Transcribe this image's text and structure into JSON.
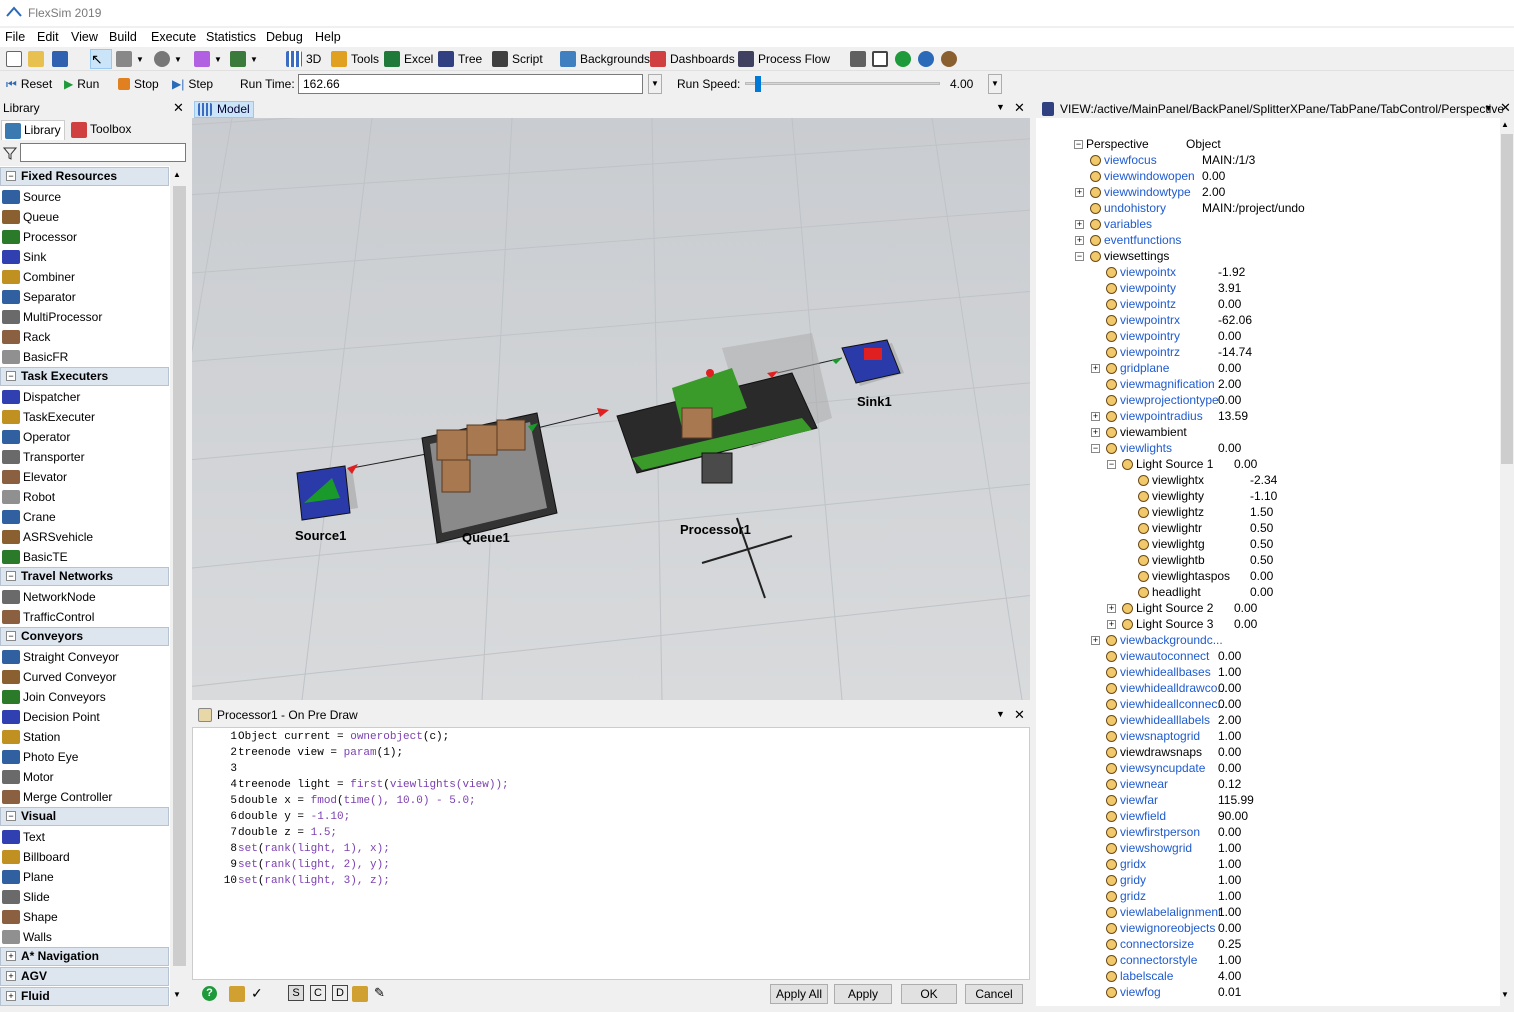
{
  "app": {
    "title": "FlexSim 2019",
    "menu": [
      "File",
      "Edit",
      "View",
      "Build",
      "Execute",
      "Statistics",
      "Debug",
      "Help"
    ]
  },
  "toolbar": {
    "d3": "3D",
    "tools": "Tools",
    "excel": "Excel",
    "tree": "Tree",
    "script": "Script",
    "backgrounds": "Backgrounds",
    "dashboards": "Dashboards",
    "processflow": "Process Flow"
  },
  "runbar": {
    "reset": "Reset",
    "run": "Run",
    "stop": "Stop",
    "step": "Step",
    "runtime_label": "Run Time:",
    "runtime_value": "162.66",
    "runspeed_label": "Run Speed:",
    "runspeed_value": "4.00",
    "runspeed_level": 0.05
  },
  "library": {
    "title": "Library",
    "tab_library": "Library",
    "tab_toolbox": "Toolbox",
    "categories": [
      {
        "name": "Fixed Resources",
        "items": [
          "Source",
          "Queue",
          "Processor",
          "Sink",
          "Combiner",
          "Separator",
          "MultiProcessor",
          "Rack",
          "BasicFR"
        ]
      },
      {
        "name": "Task Executers",
        "items": [
          "Dispatcher",
          "TaskExecuter",
          "Operator",
          "Transporter",
          "Elevator",
          "Robot",
          "Crane",
          "ASRSvehicle",
          "BasicTE"
        ]
      },
      {
        "name": "Travel Networks",
        "items": [
          "NetworkNode",
          "TrafficControl"
        ]
      },
      {
        "name": "Conveyors",
        "items": [
          "Straight Conveyor",
          "Curved Conveyor",
          "Join Conveyors",
          "Decision Point",
          "Station",
          "Photo Eye",
          "Motor",
          "Merge Controller"
        ]
      },
      {
        "name": "Visual",
        "items": [
          "Text",
          "Billboard",
          "Plane",
          "Slide",
          "Shape",
          "Walls"
        ]
      },
      {
        "name": "A* Navigation",
        "items": []
      },
      {
        "name": "AGV",
        "items": []
      },
      {
        "name": "Fluid",
        "items": []
      }
    ]
  },
  "model": {
    "tab": "Model",
    "labels": {
      "source": "Source1",
      "queue": "Queue1",
      "processor": "Processor1",
      "sink": "Sink1"
    }
  },
  "code": {
    "title": "Processor1 - On Pre Draw",
    "lines": [
      [
        "1",
        "Object current = ",
        "ownerobject",
        "(c);",
        ""
      ],
      [
        "2",
        "treenode view = ",
        "param",
        "(1);",
        ""
      ],
      [
        "3",
        "",
        "",
        "",
        ""
      ],
      [
        "4",
        "treenode light = ",
        "first",
        "(",
        "viewlights(view));"
      ],
      [
        "5",
        "double x = ",
        "fmod",
        "(",
        "time(), 10.0) - 5.0;"
      ],
      [
        "6",
        "double y = ",
        "",
        "",
        "-1.10;"
      ],
      [
        "7",
        "double z = ",
        "",
        "",
        "1.5;"
      ],
      [
        "8",
        "",
        "set",
        "(",
        "rank(light, 1), x);"
      ],
      [
        "9",
        "",
        "set",
        "(",
        "rank(light, 2), y);"
      ],
      [
        "10",
        "",
        "set",
        "(",
        "rank(light, 3), z);"
      ]
    ],
    "buttons": {
      "apply_all": "Apply All",
      "apply": "Apply",
      "ok": "OK",
      "cancel": "Cancel"
    }
  },
  "tree": {
    "title": "VIEW:/active/MainPanel/BackPanel/SplitterXPane/TabPane/TabControl/Perspective",
    "root": "Perspective",
    "root_value": "Object",
    "nodes": [
      {
        "name": "viewfocus",
        "value": "MAIN:/1/3",
        "level": 1,
        "blue": true,
        "pm": ""
      },
      {
        "name": "viewwindowopen",
        "value": "0.00",
        "level": 1,
        "blue": true,
        "pm": ""
      },
      {
        "name": "viewwindowtype",
        "value": "2.00",
        "level": 1,
        "blue": true,
        "pm": "+"
      },
      {
        "name": "undohistory",
        "value": "MAIN:/project/undo",
        "level": 1,
        "blue": true,
        "pm": ""
      },
      {
        "name": "variables",
        "value": "",
        "level": 1,
        "blue": true,
        "pm": "+"
      },
      {
        "name": "eventfunctions",
        "value": "",
        "level": 1,
        "blue": true,
        "pm": "+"
      },
      {
        "name": "viewsettings",
        "value": "",
        "level": 1,
        "blue": false,
        "pm": "-"
      },
      {
        "name": "viewpointx",
        "value": "-1.92",
        "level": 2,
        "blue": true,
        "pm": ""
      },
      {
        "name": "viewpointy",
        "value": "3.91",
        "level": 2,
        "blue": true,
        "pm": ""
      },
      {
        "name": "viewpointz",
        "value": "0.00",
        "level": 2,
        "blue": true,
        "pm": ""
      },
      {
        "name": "viewpointrx",
        "value": "-62.06",
        "level": 2,
        "blue": true,
        "pm": ""
      },
      {
        "name": "viewpointry",
        "value": "0.00",
        "level": 2,
        "blue": true,
        "pm": ""
      },
      {
        "name": "viewpointrz",
        "value": "-14.74",
        "level": 2,
        "blue": true,
        "pm": ""
      },
      {
        "name": "gridplane",
        "value": "0.00",
        "level": 2,
        "blue": true,
        "pm": "+"
      },
      {
        "name": "viewmagnification",
        "value": "2.00",
        "level": 2,
        "blue": true,
        "pm": ""
      },
      {
        "name": "viewprojectiontype",
        "value": "0.00",
        "level": 2,
        "blue": true,
        "pm": ""
      },
      {
        "name": "viewpointradius",
        "value": "13.59",
        "level": 2,
        "blue": true,
        "pm": "+"
      },
      {
        "name": "viewambient",
        "value": "",
        "level": 2,
        "blue": false,
        "pm": "+"
      },
      {
        "name": "viewlights",
        "value": "0.00",
        "level": 2,
        "blue": true,
        "pm": "-"
      },
      {
        "name": "Light Source 1",
        "value": "0.00",
        "level": 3,
        "blue": false,
        "pm": "-"
      },
      {
        "name": "viewlightx",
        "value": "-2.34",
        "level": 4,
        "blue": false,
        "pm": ""
      },
      {
        "name": "viewlighty",
        "value": "-1.10",
        "level": 4,
        "blue": false,
        "pm": ""
      },
      {
        "name": "viewlightz",
        "value": "1.50",
        "level": 4,
        "blue": false,
        "pm": ""
      },
      {
        "name": "viewlightr",
        "value": "0.50",
        "level": 4,
        "blue": false,
        "pm": ""
      },
      {
        "name": "viewlightg",
        "value": "0.50",
        "level": 4,
        "blue": false,
        "pm": ""
      },
      {
        "name": "viewlightb",
        "value": "0.50",
        "level": 4,
        "blue": false,
        "pm": ""
      },
      {
        "name": "viewlightaspos",
        "value": "0.00",
        "level": 4,
        "blue": false,
        "pm": ""
      },
      {
        "name": "headlight",
        "value": "0.00",
        "level": 4,
        "blue": false,
        "pm": ""
      },
      {
        "name": "Light Source 2",
        "value": "0.00",
        "level": 3,
        "blue": false,
        "pm": "+"
      },
      {
        "name": "Light Source 3",
        "value": "0.00",
        "level": 3,
        "blue": false,
        "pm": "+"
      },
      {
        "name": "viewbackgroundc...",
        "value": "",
        "level": 2,
        "blue": true,
        "pm": "+"
      },
      {
        "name": "viewautoconnect",
        "value": "0.00",
        "level": 2,
        "blue": true,
        "pm": ""
      },
      {
        "name": "viewhideallbases",
        "value": "1.00",
        "level": 2,
        "blue": true,
        "pm": ""
      },
      {
        "name": "viewhidealldrawco...",
        "value": "0.00",
        "level": 2,
        "blue": true,
        "pm": ""
      },
      {
        "name": "viewhideallconnec...",
        "value": "0.00",
        "level": 2,
        "blue": true,
        "pm": ""
      },
      {
        "name": "viewhidealllabels",
        "value": "2.00",
        "level": 2,
        "blue": true,
        "pm": ""
      },
      {
        "name": "viewsnaptogrid",
        "value": "1.00",
        "level": 2,
        "blue": true,
        "pm": ""
      },
      {
        "name": "viewdrawsnaps",
        "value": "0.00",
        "level": 2,
        "blue": false,
        "pm": ""
      },
      {
        "name": "viewsyncupdate",
        "value": "0.00",
        "level": 2,
        "blue": true,
        "pm": ""
      },
      {
        "name": "viewnear",
        "value": "0.12",
        "level": 2,
        "blue": true,
        "pm": ""
      },
      {
        "name": "viewfar",
        "value": "115.99",
        "level": 2,
        "blue": true,
        "pm": ""
      },
      {
        "name": "viewfield",
        "value": "90.00",
        "level": 2,
        "blue": true,
        "pm": ""
      },
      {
        "name": "viewfirstperson",
        "value": "0.00",
        "level": 2,
        "blue": true,
        "pm": ""
      },
      {
        "name": "viewshowgrid",
        "value": "1.00",
        "level": 2,
        "blue": true,
        "pm": ""
      },
      {
        "name": "gridx",
        "value": "1.00",
        "level": 2,
        "blue": true,
        "pm": ""
      },
      {
        "name": "gridy",
        "value": "1.00",
        "level": 2,
        "blue": true,
        "pm": ""
      },
      {
        "name": "gridz",
        "value": "1.00",
        "level": 2,
        "blue": true,
        "pm": ""
      },
      {
        "name": "viewlabelalignment",
        "value": "1.00",
        "level": 2,
        "blue": true,
        "pm": ""
      },
      {
        "name": "viewignoreobjects",
        "value": "0.00",
        "level": 2,
        "blue": true,
        "pm": ""
      },
      {
        "name": "connectorsize",
        "value": "0.25",
        "level": 2,
        "blue": true,
        "pm": ""
      },
      {
        "name": "connectorstyle",
        "value": "1.00",
        "level": 2,
        "blue": true,
        "pm": ""
      },
      {
        "name": "labelscale",
        "value": "4.00",
        "level": 2,
        "blue": true,
        "pm": ""
      },
      {
        "name": "viewfog",
        "value": "0.01",
        "level": 2,
        "blue": true,
        "pm": ""
      }
    ]
  }
}
